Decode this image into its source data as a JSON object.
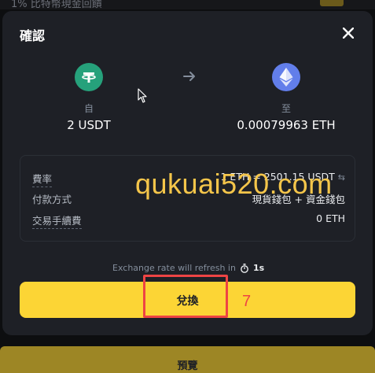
{
  "background": {
    "top_text": "1% 比特幣現金回饋",
    "bottom_button_label": "預覽"
  },
  "modal": {
    "title": "確認",
    "from": {
      "label": "自",
      "amount": "2 USDT",
      "icon": "usdt-coin-icon",
      "color": "#26a17b"
    },
    "to": {
      "label": "至",
      "amount": "0.00079963 ETH",
      "icon": "eth-coin-icon",
      "color": "#627eea"
    },
    "details": [
      {
        "key": "費率",
        "value": "1 ETH = 2501.15 USDT"
      },
      {
        "key": "付款方式",
        "value": "現貨錢包 + 資金錢包"
      },
      {
        "key": "交易手續費",
        "value": "0 ETH"
      }
    ],
    "refresh_text": "Exchange rate will refresh in",
    "refresh_count": "1s",
    "convert_label": "兌換"
  },
  "overlay": {
    "watermark": "qukuai520.com",
    "step_number": "7"
  },
  "colors": {
    "accent": "#fcd535",
    "panel": "#1e2026",
    "annotation": "#ee4444"
  }
}
